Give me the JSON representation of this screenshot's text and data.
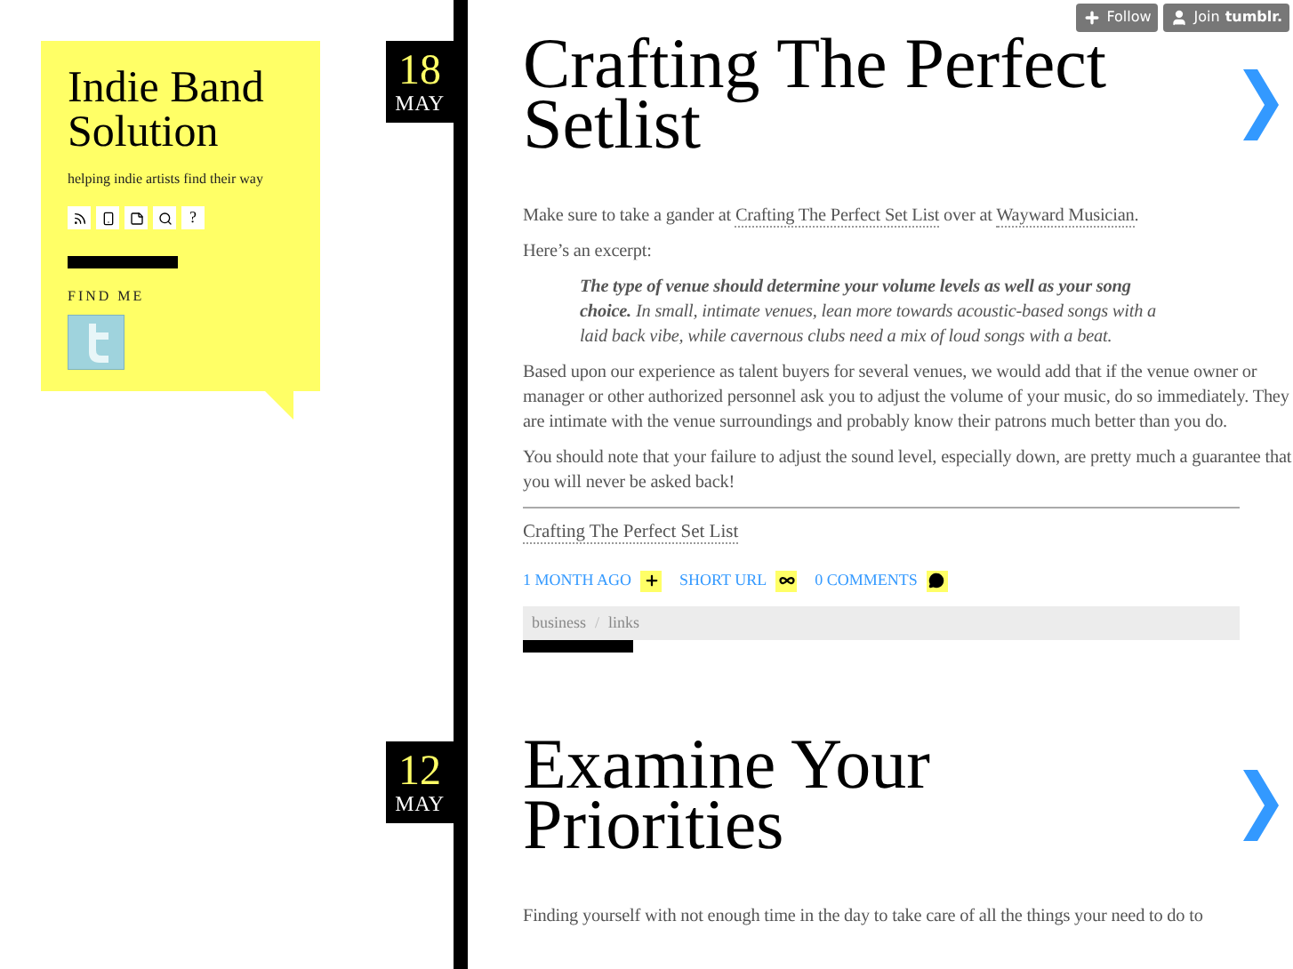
{
  "top_buttons": [
    {
      "kind": "follow",
      "label": "Follow"
    },
    {
      "kind": "join",
      "label": "Join",
      "brand": "tumblr."
    }
  ],
  "sidebar": {
    "title": "Indie Band Solution",
    "tagline": "helping indie artists find their way",
    "icons": [
      {
        "kind": "rss"
      },
      {
        "kind": "mobile"
      },
      {
        "kind": "note"
      },
      {
        "kind": "search"
      },
      {
        "kind": "text",
        "label": "?"
      }
    ],
    "find_me": "FIND ME"
  },
  "posts": [
    {
      "day": "18",
      "month": "MAY",
      "title": "Crafting The Perfect Setlist",
      "body": [
        {
          "kind": "paragraph",
          "segments": [
            {
              "kind": "text",
              "text": "Make sure to take a gander at "
            },
            {
              "kind": "link",
              "text": "Crafting The Perfect Set List"
            },
            {
              "kind": "text",
              "text": " over at "
            },
            {
              "kind": "link",
              "text": "Wayward Musician"
            },
            {
              "kind": "text",
              "text": "."
            }
          ]
        },
        {
          "kind": "paragraph",
          "segments": [
            {
              "kind": "text",
              "text": "Here’s an excerpt:"
            }
          ]
        },
        {
          "kind": "quote",
          "text": "**The type of venue should determine your volume levels as well as your song choice.** In small, intimate venues, lean more towards acoustic-based songs with a laid back vibe, while cavernous clubs need a mix of loud songs with a beat."
        },
        {
          "kind": "paragraph",
          "segments": [
            {
              "kind": "text",
              "text": "Based upon our experience as talent buyers for several venues, we would add that if the venue owner or manager or other authorized personnel ask you to adjust the volume of your music, do so immediately. They are intimate with the venue surroundings and probably know their patrons much better than you do."
            }
          ]
        },
        {
          "kind": "paragraph",
          "segments": [
            {
              "kind": "text",
              "text": "You should note that your failure to adjust the sound level, especially down, are pretty much a guarantee that you will never be asked back!"
            }
          ]
        }
      ],
      "source_link": "Crafting The Perfect Set List",
      "meta": [
        {
          "kind": "time",
          "label": "1 MONTH AGO"
        },
        {
          "kind": "link",
          "label": "SHORT URL"
        },
        {
          "kind": "comments",
          "label": "0 COMMENTS"
        }
      ],
      "tags": [
        "business",
        "links"
      ],
      "tag_separator": "/"
    },
    {
      "day": "12",
      "month": "MAY",
      "title": "Examine Your Priorities",
      "body": [
        {
          "kind": "paragraph",
          "segments": [
            {
              "kind": "text",
              "text": "Finding yourself with not enough time in the day to take care of all the things your need to do to"
            }
          ]
        }
      ]
    }
  ]
}
